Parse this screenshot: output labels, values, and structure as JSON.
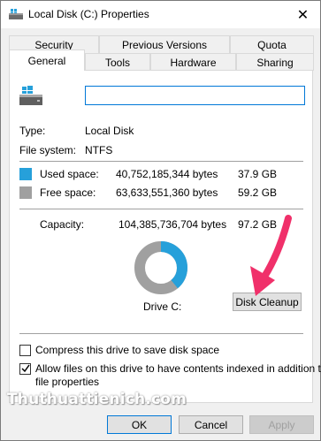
{
  "window": {
    "title": "Local Disk (C:) Properties",
    "close_glyph": "✕"
  },
  "tabs": {
    "row1": [
      "Security",
      "Previous Versions",
      "Quota"
    ],
    "row2": [
      "General",
      "Tools",
      "Hardware",
      "Sharing"
    ],
    "active": "General"
  },
  "general": {
    "name_value": "",
    "type_label": "Type:",
    "type_value": "Local Disk",
    "fs_label": "File system:",
    "fs_value": "NTFS",
    "used": {
      "label": "Used space:",
      "bytes": "40,752,185,344 bytes",
      "size": "37.9 GB",
      "color": "#26a0da"
    },
    "free": {
      "label": "Free space:",
      "bytes": "63,633,551,360 bytes",
      "size": "59.2 GB",
      "color": "#a0a0a0"
    },
    "capacity": {
      "label": "Capacity:",
      "bytes": "104,385,736,704 bytes",
      "size": "97.2 GB"
    },
    "used_fraction": 0.39,
    "drive_label": "Drive C:",
    "cleanup_button": "Disk Cleanup",
    "compress_label": "Compress this drive to save disk space",
    "compress_checked": false,
    "index_label_line1": "Allow files on this drive to have contents indexed in addition to",
    "index_label_line2": "file properties",
    "index_checked": true
  },
  "footer": {
    "ok": "OK",
    "cancel": "Cancel",
    "apply": "Apply"
  },
  "watermark": "Thuthuattienich.com",
  "annotation_color": "#f0306a",
  "icons": [
    "drive-icon",
    "close-icon",
    "checkmark-icon",
    "arrow-icon"
  ]
}
